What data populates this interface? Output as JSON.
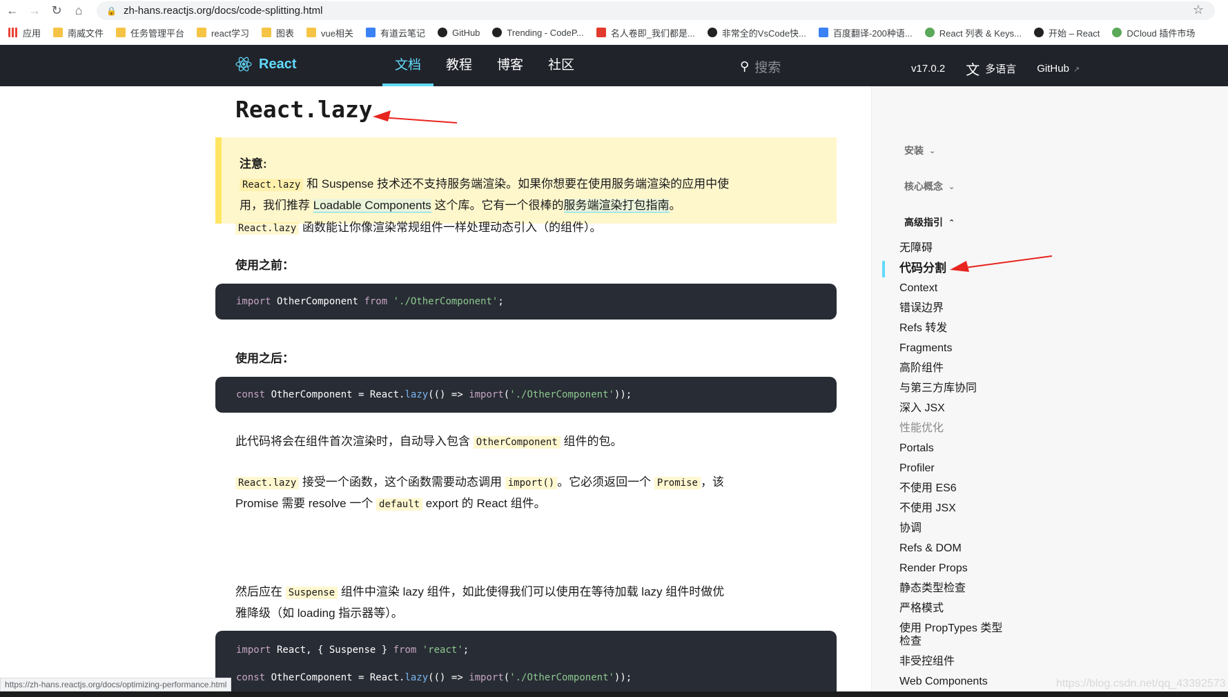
{
  "browser": {
    "url": "zh-hans.reactjs.org/docs/code-splitting.html",
    "bookmarks": [
      {
        "label": "应用",
        "icon": "apps-icon"
      },
      {
        "label": "南威文件",
        "icon": "folder-icon"
      },
      {
        "label": "任务管理平台",
        "icon": "folder-icon"
      },
      {
        "label": "react学习",
        "icon": "folder-icon"
      },
      {
        "label": "图表",
        "icon": "folder-icon"
      },
      {
        "label": "vue相关",
        "icon": "folder-icon"
      },
      {
        "label": "有道云笔记",
        "icon": "note-icon"
      },
      {
        "label": "GitHub",
        "icon": "github-icon"
      },
      {
        "label": "Trending - CodeP...",
        "icon": "codepen-icon"
      },
      {
        "label": "名人卷即_我们都是...",
        "icon": "c-icon"
      },
      {
        "label": "非常全的VsCode快...",
        "icon": "feather-icon"
      },
      {
        "label": "百度翻译-200种语...",
        "icon": "translate-icon"
      },
      {
        "label": "React 列表 & Keys...",
        "icon": "react-icon"
      },
      {
        "label": "开始 – React",
        "icon": "react-icon"
      },
      {
        "label": "DCloud 插件市场",
        "icon": "dcloud-icon"
      }
    ]
  },
  "header": {
    "logo": "React",
    "nav": [
      "文档",
      "教程",
      "博客",
      "社区"
    ],
    "search_placeholder": "搜索",
    "version": "v17.0.2",
    "language": "多语言",
    "github": "GitHub"
  },
  "main": {
    "title": "React.lazy",
    "note": {
      "head": "注意:",
      "code": "React.lazy",
      "text1": " 和 Suspense 技术还不支持服务端渲染。如果你想要在使用服务端渲染的应用中使",
      "text2": "用，我们推荐 ",
      "link1": "Loadable Components",
      "text3": " 这个库。它有一个很棒的",
      "link2": "服务端渲染打包指南",
      "text4": "。"
    },
    "p1_code": "React.lazy",
    "p1_text": " 函数能让你像渲染常规组件一样处理动态引入（的组件）。",
    "before_label": "使用之前：",
    "code1": {
      "kw1": "import",
      "id": " OtherComponent ",
      "kw2": "from",
      "str": " './OtherComponent'",
      "end": ";"
    },
    "after_label": "使用之后：",
    "code2": {
      "kw1": "const",
      "id": " OtherComponent = React.",
      "fn": "lazy",
      "p1": "(() => ",
      "kw2": "import",
      "p2": "(",
      "str": "'./OtherComponent'",
      "end": "));"
    },
    "p2_text1": "此代码将会在组件首次渲染时，自动导入包含 ",
    "p2_code": "OtherComponent",
    "p2_text2": " 组件的包。",
    "p3_code1": "React.lazy",
    "p3_text1": " 接受一个函数，这个函数需要动态调用 ",
    "p3_code2": "import()",
    "p3_text2": "。它必须返回一个 ",
    "p3_code3": "Promise",
    "p3_text3": "，该",
    "p3_text4": "Promise 需要 resolve 一个 ",
    "p3_code4": "default",
    "p3_text5": " export 的 React 组件。",
    "p4_text1": "然后应在 ",
    "p4_code": "Suspense",
    "p4_text2": " 组件中渲染 lazy 组件，如此使得我们可以使用在等待加载 lazy 组件时做优",
    "p4_text3": "雅降级（如 loading 指示器等）。",
    "code3": {
      "l1_kw1": "import",
      "l1_id": " React, { Suspense } ",
      "l1_kw2": "from",
      "l1_str": " 'react'",
      "l1_end": ";",
      "l2_kw1": "const",
      "l2_id": " OtherComponent = React.",
      "l2_fn": "lazy",
      "l2_p1": "(() => ",
      "l2_kw2": "import",
      "l2_p2": "(",
      "l2_str": "'./OtherComponent'",
      "l2_end": "));"
    }
  },
  "sidebar": {
    "sections": [
      {
        "label": "安装",
        "chev": "⌄"
      },
      {
        "label": "核心概念",
        "chev": "⌄"
      },
      {
        "label": "高级指引",
        "chev": "⌃"
      }
    ],
    "items": [
      "无障碍",
      "代码分割",
      "Context",
      "错误边界",
      "Refs 转发",
      "Fragments",
      "高阶组件",
      "与第三方库协同",
      "深入 JSX",
      "性能优化",
      "Portals",
      "Profiler",
      "不使用 ES6",
      "不使用 JSX",
      "协调",
      "Refs & DOM",
      "Render Props",
      "静态类型检查",
      "严格模式",
      "使用 PropTypes 类型检查",
      "非受控组件",
      "Web Components"
    ]
  },
  "status_url": "https://zh-hans.reactjs.org/docs/optimizing-performance.html",
  "watermark": "https://blog.csdn.net/qq_43392573",
  "colors": {
    "accent": "#61dafb",
    "header_bg": "#20232a",
    "note_bg": "#fff7cc",
    "note_border": "#ffe564",
    "code_bg": "#282c34",
    "arrow": "#e8251f"
  }
}
